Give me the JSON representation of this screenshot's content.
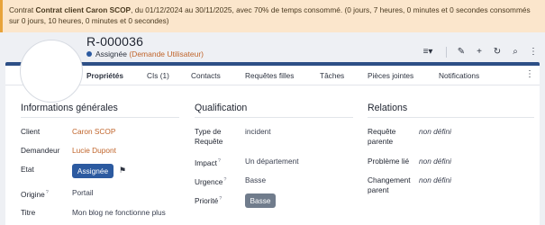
{
  "banner": {
    "prefix": "Contrat ",
    "contract_name": "Contrat client Caron SCOP",
    "rest": ", du 01/12/2024 au 30/11/2025, avec 70% de temps consommé. (0 jours, 7 heures, 0 minutes et 0 secondes consommés sur 0 jours, 10 heures, 0 minutes et 0 secondes)"
  },
  "header": {
    "ref": "R-000036",
    "status": "Assignée",
    "requester_link": "(Demande Utilisateur)"
  },
  "toolbar": {
    "icons": [
      "actions-dropdown-icon",
      "edit-icon",
      "add-icon",
      "refresh-icon",
      "search-icon",
      "more-icon"
    ],
    "glyphs": [
      "≡▾",
      "✎",
      "+",
      "↻",
      "⌕",
      "⋮"
    ]
  },
  "tabs": [
    "Propriétés",
    "CIs (1)",
    "Contacts",
    "Requêtes filles",
    "Tâches",
    "Pièces jointes",
    "Notifications"
  ],
  "sections": {
    "general": {
      "title": "Informations générales",
      "fields": [
        {
          "label": "Client",
          "value": "Caron SCOP"
        },
        {
          "label": "Demandeur",
          "value": "Lucie Dupont"
        },
        {
          "label": "Etat",
          "value": "Assignée"
        },
        {
          "label": "Origine",
          "value": "Portail"
        },
        {
          "label": "Titre",
          "value": "Mon blog ne fonctionne plus"
        }
      ]
    },
    "qualification": {
      "title": "Qualification",
      "fields": [
        {
          "label": "Type de Requête",
          "value": "incident"
        },
        {
          "label": "Impact",
          "value": "Un département"
        },
        {
          "label": "Urgence",
          "value": "Basse"
        },
        {
          "label": "Priorité",
          "value": "Basse"
        }
      ]
    },
    "relations": {
      "title": "Relations",
      "fields": [
        {
          "label": "Requête parente",
          "value": "non défini"
        },
        {
          "label": "Problème lié",
          "value": "non défini"
        },
        {
          "label": "Changement parent",
          "value": "non défini"
        }
      ]
    }
  },
  "help_mark": "?",
  "colors": {
    "accent": "#2c5aa0",
    "link": "#c0642a",
    "banner_bg": "#fbe6cc",
    "priority_badge": "#707c8c"
  }
}
